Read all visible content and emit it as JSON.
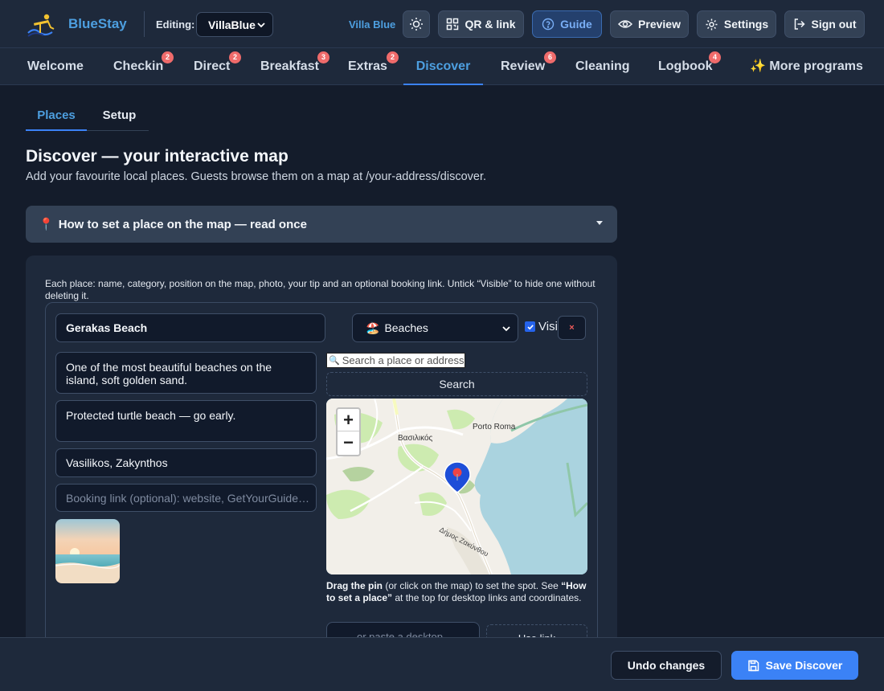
{
  "header": {
    "brand": "BlueStay",
    "editing_label": "Editing:",
    "property_selected": "VillaBlue",
    "villa_name": "Villa Blue",
    "buttons": {
      "theme_toggle": "sun-icon",
      "qr_link": "QR & link",
      "guide": "Guide",
      "preview": "Preview",
      "settings": "Settings",
      "sign_out": "Sign out"
    }
  },
  "main_tabs": [
    {
      "label": "Welcome",
      "badge": null
    },
    {
      "label": "Checkin",
      "badge": "2"
    },
    {
      "label": "Direct",
      "badge": "2"
    },
    {
      "label": "Breakfast",
      "badge": "3"
    },
    {
      "label": "Extras",
      "badge": "2"
    },
    {
      "label": "Discover",
      "badge": null,
      "active": true
    },
    {
      "label": "Review",
      "badge": "6"
    },
    {
      "label": "Cleaning",
      "badge": null
    },
    {
      "label": "Logbook",
      "badge": "4"
    },
    {
      "label": "✨ More programs",
      "badge": null
    }
  ],
  "sub_tabs": [
    {
      "label": "Places",
      "active": true
    },
    {
      "label": "Setup",
      "active": false
    }
  ],
  "page": {
    "title": "Discover — your interactive map",
    "subtitle": "Add your favourite local places. Guests browse them on a map at /your-address/discover."
  },
  "howto": {
    "icon": "📍",
    "label": "How to set a place on the map — read once"
  },
  "places_panel": {
    "note": "Each place: name, category, position on the map, photo, your tip and an optional booking link. Untick “Visible” to hide one without deleting it.",
    "place": {
      "name": "Gerakas Beach",
      "category_icon": "🏖️",
      "category": "Beaches",
      "visible_label": "Visible",
      "visible": true,
      "delete_label": "×",
      "description": "One of the most beautiful beaches on the island, soft golden sand.",
      "tip": "Protected turtle beach — go early.",
      "address": "Vasilikos, Zakynthos",
      "booking_placeholder": "Booking link (optional): website, GetYourGuide…",
      "map_search_placeholder": "Search a place or address",
      "search_button": "Search",
      "map_labels": {
        "town1": "Porto Roma",
        "town2": "Βασιλικός",
        "road": "Δήμος Ζακύνθου"
      },
      "zoom_in": "+",
      "zoom_out": "−",
      "hint_bold1": "Drag the pin",
      "hint_text1": " (or click on the map) to set the spot. See ",
      "hint_bold2": "“How to set a place”",
      "hint_text2": " at the top for desktop links and coordinates.",
      "paste_placeholder": "…or paste a desktop Google",
      "use_link": "Use link"
    }
  },
  "footer": {
    "undo": "Undo changes",
    "save": "Save Discover"
  },
  "colors": {
    "accent": "#3b82f6",
    "brand": "#4d9fe0",
    "badge": "#ef6b6b",
    "background": "#141c2b",
    "surface": "#1e293b"
  }
}
